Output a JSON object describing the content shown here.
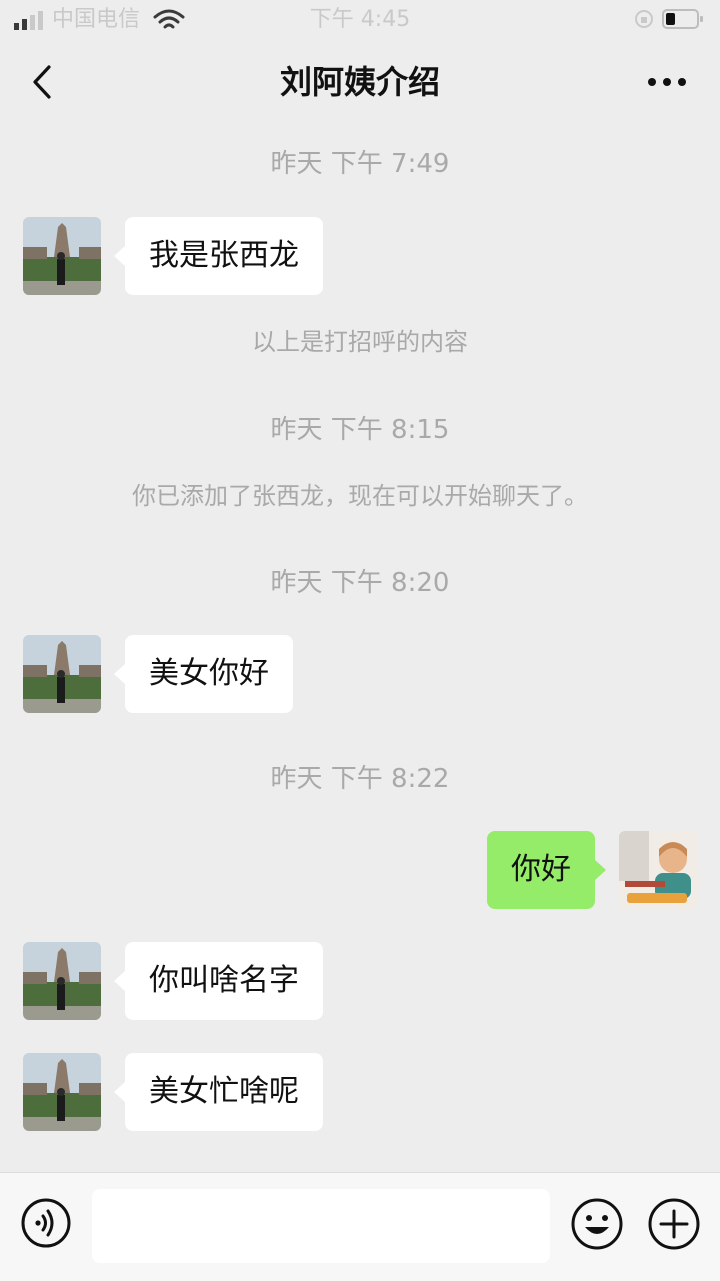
{
  "status_bar": {
    "carrier": "中国电信",
    "time": "下午 4:45"
  },
  "nav": {
    "title": "刘阿姨介绍"
  },
  "messages": [
    {
      "type": "timestamp",
      "text": "昨天 下午 7:49"
    },
    {
      "type": "incoming",
      "text": "我是张西龙"
    },
    {
      "type": "system",
      "text": "以上是打招呼的内容"
    },
    {
      "type": "timestamp",
      "text": "昨天 下午 8:15"
    },
    {
      "type": "system",
      "text": "你已添加了张西龙，现在可以开始聊天了。"
    },
    {
      "type": "timestamp",
      "text": "昨天 下午 8:20"
    },
    {
      "type": "incoming",
      "text": "美女你好"
    },
    {
      "type": "timestamp",
      "text": "昨天 下午 8:22"
    },
    {
      "type": "outgoing",
      "text": "你好"
    },
    {
      "type": "incoming",
      "text": "你叫啥名字"
    },
    {
      "type": "incoming",
      "text": "美女忙啥呢"
    }
  ],
  "input_bar": {
    "value": "",
    "placeholder": "",
    "icons": [
      "voice-icon",
      "emoji-icon",
      "plus-icon"
    ]
  },
  "colors": {
    "background": "#ededed",
    "incoming_bubble": "#ffffff",
    "outgoing_bubble": "#95ec69",
    "meta_text": "#a9a9a9"
  }
}
